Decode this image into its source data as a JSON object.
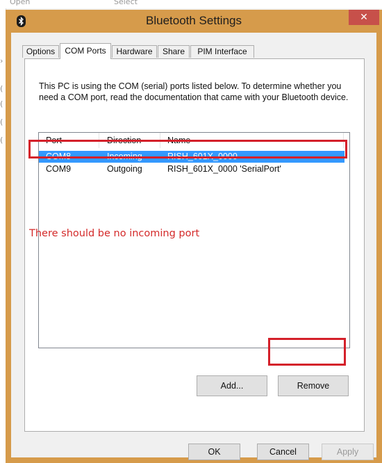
{
  "background": {
    "top_labels": [
      "Open",
      "Select"
    ],
    "left_glyphs": [
      "›",
      "(",
      "(",
      "(",
      "("
    ]
  },
  "window": {
    "title": "Bluetooth Settings",
    "close_label": "✕",
    "app_icon": "bluetooth-icon",
    "accent_color": "#d69b4b",
    "close_color": "#c7504a"
  },
  "tabs": [
    {
      "label": "Options",
      "active": false
    },
    {
      "label": "COM Ports",
      "active": true
    },
    {
      "label": "Hardware",
      "active": false
    },
    {
      "label": "Share",
      "active": false
    },
    {
      "label": "PIM Interface",
      "active": false
    }
  ],
  "description": "This PC is using the COM (serial) ports listed below. To determine whether you need a COM port, read the documentation that came with your Bluetooth device.",
  "ports_table": {
    "columns": [
      "Port",
      "Direction",
      "Name"
    ],
    "rows": [
      {
        "port": "COM8",
        "direction": "Incoming",
        "name": "RISH_601X_0000",
        "selected": true
      },
      {
        "port": "COM9",
        "direction": "Outgoing",
        "name": "RISH_601X_0000 'SerialPort'",
        "selected": false
      }
    ],
    "selection_color": "#3399ff"
  },
  "annotation": {
    "text": "There should be no incoming port",
    "color": "#d42a2a"
  },
  "buttons": {
    "add": "Add...",
    "remove": "Remove",
    "ok": "OK",
    "cancel": "Cancel",
    "apply": "Apply"
  }
}
